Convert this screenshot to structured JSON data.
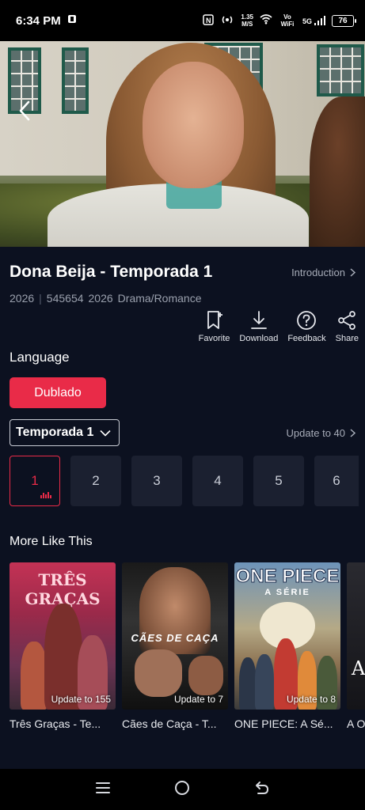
{
  "status_bar": {
    "time": "6:34 PM",
    "speed": "1.35",
    "speed_unit": "M/S",
    "vowifi": "Vo WiFi",
    "network": "5G",
    "battery": "76"
  },
  "show": {
    "title": "Dona Beija - Temporada 1",
    "intro_link": "Introduction",
    "meta": [
      "2026",
      "545654",
      "2026",
      "Drama/Romance"
    ]
  },
  "actions": [
    {
      "label": "Favorite",
      "icon": "bookmark-plus-icon"
    },
    {
      "label": "Download",
      "icon": "download-icon"
    },
    {
      "label": "Feedback",
      "icon": "help-circle-icon"
    },
    {
      "label": "Share",
      "icon": "share-icon"
    }
  ],
  "language": {
    "label": "Language",
    "selected": "Dublado"
  },
  "season": {
    "selected": "Temporada 1",
    "update_text": "Update to 40"
  },
  "episodes": [
    "1",
    "2",
    "3",
    "4",
    "5",
    "6"
  ],
  "more_like_this": {
    "title": "More Like This",
    "items": [
      {
        "title": "Três Graças - Te...",
        "update": "Update to 155",
        "poster_text": "TRÊS GRAÇAS"
      },
      {
        "title": "Cães de Caça - T...",
        "update": "Update to 7",
        "poster_text": "CÃES DE CAÇA"
      },
      {
        "title": "ONE PIECE: A Sé...",
        "update": "Update to 8",
        "poster_text": "ONE PIECE",
        "poster_sub": "A SÉRIE"
      },
      {
        "title": "A O",
        "update": "",
        "poster_text": "A"
      }
    ]
  },
  "colors": {
    "accent": "#e92b48",
    "background": "#0c1120",
    "tile": "#1b2030"
  }
}
